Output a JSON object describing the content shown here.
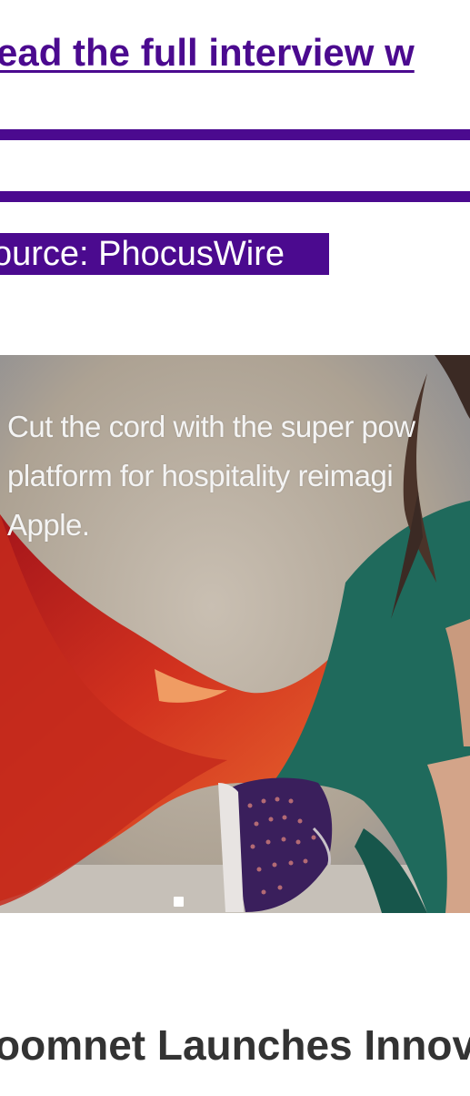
{
  "links": {
    "interview": "ead the full interview w"
  },
  "source": {
    "label": "ource: PhocusWire"
  },
  "hero": {
    "caption_lines": [
      "Cut the cord with the super pow",
      "platform for hospitality reimagi",
      "Apple."
    ]
  },
  "article": {
    "headline": "oomnet Launches Innov"
  },
  "colors": {
    "accent": "#4b0a8f",
    "headline_text": "#333333",
    "cape_red": "#c8241c",
    "outfit_teal": "#1f6a5c"
  }
}
